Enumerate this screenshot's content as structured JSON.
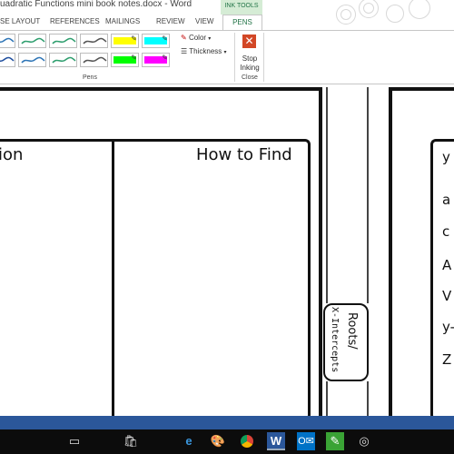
{
  "window": {
    "title": "uadratic Functions mini book notes.docx - Word",
    "context_tab": "INK TOOLS"
  },
  "tabs": [
    {
      "label": "SE LAYOUT"
    },
    {
      "label": "REFERENCES"
    },
    {
      "label": "MAILINGS"
    },
    {
      "label": "REVIEW"
    },
    {
      "label": "VIEW"
    },
    {
      "label": "PENS",
      "active": true
    }
  ],
  "ribbon": {
    "pens_group_label": "Pens",
    "close_group_label": "Close",
    "color_label": "Color",
    "thickness_label": "Thickness",
    "stop_label_line1": "Stop",
    "stop_label_line2": "Inking",
    "pen_swatches": [
      {
        "type": "pen",
        "color": "#2e75b6"
      },
      {
        "type": "pen",
        "color": "#2e9e6e"
      },
      {
        "type": "pen",
        "color": "#2e9e6e"
      },
      {
        "type": "pen",
        "color": "#555555"
      },
      {
        "type": "highlighter",
        "color": "#ffff00"
      },
      {
        "type": "highlighter",
        "color": "#00ffff"
      },
      {
        "type": "pen",
        "color": "#1f4e9e"
      },
      {
        "type": "pen",
        "color": "#2e75b6"
      },
      {
        "type": "pen",
        "color": "#2e9e6e"
      },
      {
        "type": "pen",
        "color": "#555555"
      },
      {
        "type": "highlighter",
        "color": "#00ff00"
      },
      {
        "type": "highlighter",
        "color": "#ff00ff"
      }
    ]
  },
  "document": {
    "left_col_header": "ion",
    "right_col_header": "How to Find",
    "side_tab_line1": "Roots/",
    "side_tab_line2": "X-Intercepts",
    "right_page_letters": [
      "y",
      "a",
      "c",
      "A",
      "V",
      "y-",
      "Z"
    ]
  },
  "taskbar": {
    "icons": [
      "task-view-icon",
      "store-icon",
      "edge-icon",
      "paint-icon",
      "chrome-icon",
      "word-icon",
      "outlook-icon",
      "green-app-icon",
      "circle-app-icon"
    ]
  },
  "colors": {
    "word_blue": "#2b579a",
    "ink_tools_green": "#217346",
    "taskbar": "#0c0c0c"
  }
}
